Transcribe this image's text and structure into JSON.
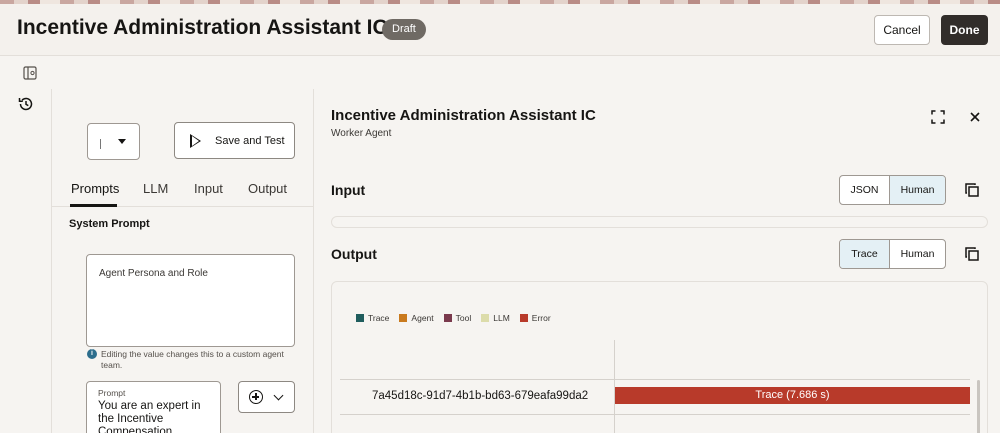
{
  "header": {
    "title": "Incentive Administration Assistant IC",
    "badge": "Draft",
    "cancel_label": "Cancel",
    "done_label": "Done"
  },
  "left_panel": {
    "save_test_label": "Save and Test",
    "tabs": [
      {
        "label": "Prompts",
        "active": true
      },
      {
        "label": "LLM",
        "active": false
      },
      {
        "label": "Input",
        "active": false
      },
      {
        "label": "Output",
        "active": false
      }
    ],
    "system_prompt_label": "System Prompt",
    "persona_label": "Agent Persona and Role",
    "info_text": "Editing the value changes this to a custom agent team.",
    "prompt_label": "Prompt",
    "prompt_text": "You are an expert in the Incentive Compensation"
  },
  "right_panel": {
    "title": "Incentive Administration Assistant IC",
    "subtitle": "Worker Agent",
    "input": {
      "title": "Input",
      "options": [
        {
          "label": "JSON",
          "selected": false
        },
        {
          "label": "Human",
          "selected": true
        }
      ]
    },
    "output": {
      "title": "Output",
      "options": [
        {
          "label": "Trace",
          "selected": true
        },
        {
          "label": "Human",
          "selected": false
        }
      ],
      "legend": [
        {
          "label": "Trace",
          "color": "#1f5d5d"
        },
        {
          "label": "Agent",
          "color": "#c97a1e"
        },
        {
          "label": "Tool",
          "color": "#7a3a4d"
        },
        {
          "label": "LLM",
          "color": "#dcdcaa"
        },
        {
          "label": "Error",
          "color": "#b83a2a"
        }
      ],
      "trace_id": "7a45d18c-91d7-4b1b-bd63-679eafa99da2",
      "trace_bar_label": "Trace (7.686 s)"
    }
  }
}
